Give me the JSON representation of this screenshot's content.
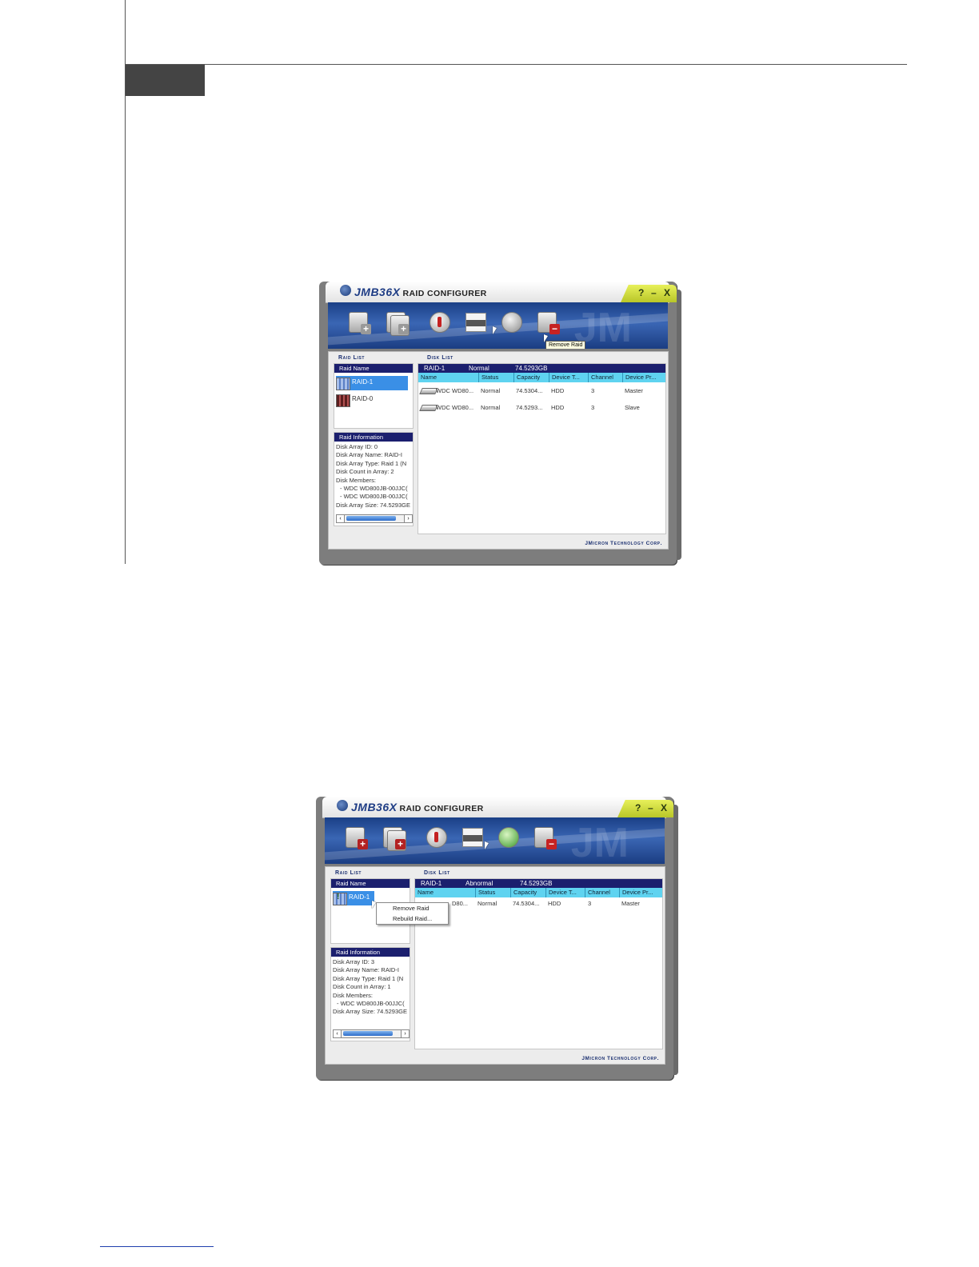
{
  "app": {
    "brand": "JMB36X",
    "title_rest": "RAID CONFIGURER",
    "controls": {
      "help": "?",
      "minimize": "–",
      "close": "X"
    },
    "watermark": "JM",
    "footer": "JMicron Technology Corp."
  },
  "screens": [
    {
      "tooltip": "Remove Raid",
      "raid_list_caption": "Raid List",
      "disk_list_caption": "Disk List",
      "raid_list_header": "Raid Name",
      "raids": [
        "RAID-1",
        "RAID-0"
      ],
      "info_header": "Raid Information",
      "info_lines": [
        "Disk Array ID: 0",
        "Disk Array Name: RAID-I",
        "Disk Array Type: Raid 1 (N",
        "Disk Count in Array: 2",
        "Disk Members:",
        "  - WDC WD800JB-00JJC(",
        "  - WDC WD800JB-00JJC(",
        "Disk Array Size: 74.5293GE"
      ],
      "summary": {
        "name": "RAID-1",
        "status": "Normal",
        "size": "74.5293GB"
      },
      "columns": [
        "Name",
        "Status",
        "Capacity",
        "Device T...",
        "Channel",
        "Device Pr..."
      ],
      "rows": [
        [
          "WDC WD80...",
          "Normal",
          "74.5304...",
          "HDD",
          "3",
          "Master"
        ],
        [
          "WDC WD80...",
          "Normal",
          "74.5293...",
          "HDD",
          "3",
          "Slave"
        ]
      ]
    },
    {
      "raid_list_caption": "Raid List",
      "disk_list_caption": "Disk List",
      "raid_list_header": "Raid Name",
      "raids": [
        "RAID-1"
      ],
      "info_header": "Raid Information",
      "info_lines": [
        "Disk Array ID: 3",
        "Disk Array Name: RAID-I",
        "Disk Array Type: Raid 1 (N",
        "Disk Count in Array: 1",
        "Disk Members:",
        "  - WDC WD800JB-00JJC(",
        "Disk Array Size: 74.5293GE"
      ],
      "summary": {
        "name": "RAID-1",
        "status": "Abnormal",
        "size": "74.5293GB"
      },
      "columns": [
        "Name",
        "Status",
        "Capacity",
        "Device T...",
        "Channel",
        "Device Pr..."
      ],
      "rows": [
        [
          "D80...",
          "Normal",
          "74.5304...",
          "HDD",
          "3",
          "Master"
        ]
      ],
      "context_menu": [
        "Remove Raid",
        "Rebuild Raid..."
      ]
    }
  ]
}
